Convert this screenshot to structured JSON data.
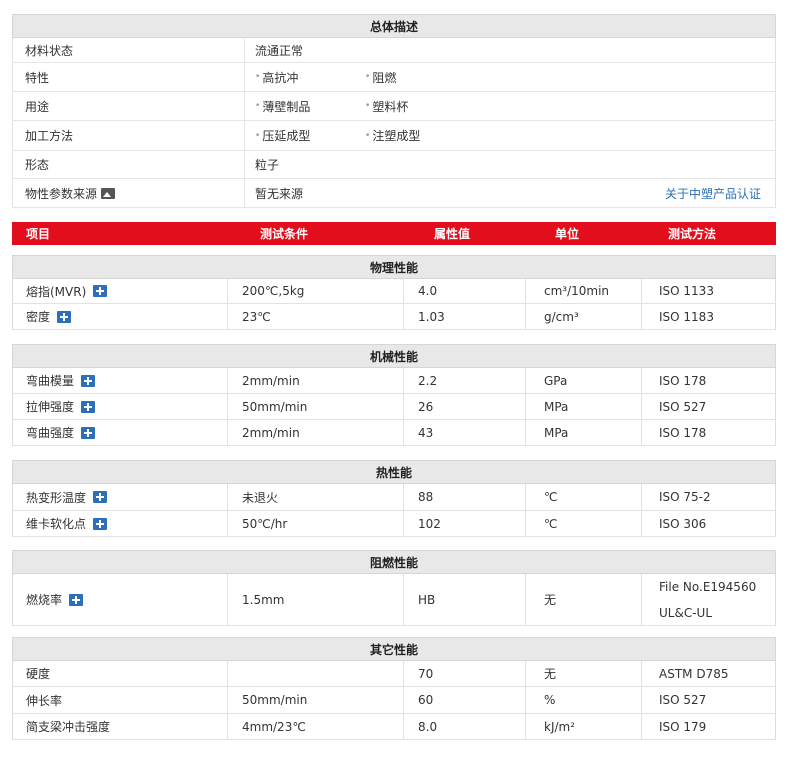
{
  "overview": {
    "title": "总体描述",
    "rows": [
      {
        "label": "材料状态",
        "values": [
          "流通正常"
        ],
        "bullets": false
      },
      {
        "label": "特性",
        "values": [
          "高抗冲",
          "阻燃"
        ],
        "bullets": true
      },
      {
        "label": "用途",
        "values": [
          "薄壁制品",
          "塑料杯"
        ],
        "bullets": true
      },
      {
        "label": "加工方法",
        "values": [
          "压延成型",
          "注塑成型"
        ],
        "bullets": true
      },
      {
        "label": "形态",
        "values": [
          "粒子"
        ],
        "bullets": false
      },
      {
        "label": "物性参数来源",
        "values": [
          "暂无来源"
        ],
        "bullets": false,
        "icon": "image-icon",
        "link": "关于中塑产品认证"
      }
    ]
  },
  "columns": [
    "项目",
    "测试条件",
    "属性值",
    "单位",
    "测试方法"
  ],
  "sections": [
    {
      "title": "物理性能",
      "rows": [
        {
          "item": "熔指(MVR)",
          "cond": "200℃,5kg",
          "value": "4.0",
          "unit": "cm³/10min",
          "method": "ISO 1133",
          "plus": true
        },
        {
          "item": "密度",
          "cond": "23℃",
          "value": "1.03",
          "unit": "g/cm³",
          "method": "ISO 1183",
          "plus": true
        }
      ]
    },
    {
      "title": "机械性能",
      "rows": [
        {
          "item": "弯曲模量",
          "cond": "2mm/min",
          "value": "2.2",
          "unit": "GPa",
          "method": "ISO 178",
          "plus": true
        },
        {
          "item": "拉伸强度",
          "cond": "50mm/min",
          "value": "26",
          "unit": "MPa",
          "method": "ISO 527",
          "plus": true
        },
        {
          "item": "弯曲强度",
          "cond": "2mm/min",
          "value": "43",
          "unit": "MPa",
          "method": "ISO 178",
          "plus": true
        }
      ]
    },
    {
      "title": "热性能",
      "rows": [
        {
          "item": "热变形温度",
          "cond": "未退火",
          "value": "88",
          "unit": "℃",
          "method": "ISO 75-2",
          "plus": true
        },
        {
          "item": "维卡软化点",
          "cond": "50℃/hr",
          "value": "102",
          "unit": "℃",
          "method": "ISO 306",
          "plus": true
        }
      ]
    },
    {
      "title": "阻燃性能",
      "rows": [
        {
          "item": "燃烧率",
          "cond": "1.5mm",
          "value": "HB",
          "unit": "无",
          "method": [
            "File No.E194560",
            "UL&C-UL"
          ],
          "plus": true
        }
      ]
    },
    {
      "title": "其它性能",
      "rows": [
        {
          "item": "硬度",
          "cond": "",
          "value": "70",
          "unit": "无",
          "method": "ASTM D785",
          "plus": false
        },
        {
          "item": "伸长率",
          "cond": "50mm/min",
          "value": "60",
          "unit": "%",
          "method": "ISO 527",
          "plus": false
        },
        {
          "item": "简支梁冲击强度",
          "cond": "4mm/23℃",
          "value": "8.0",
          "unit": "kJ/m²",
          "method": "ISO 179",
          "plus": false
        }
      ]
    }
  ],
  "colors": {
    "red": "#e30e1b",
    "link": "#2c6fbb",
    "header_gray": "#e8e8e8"
  }
}
